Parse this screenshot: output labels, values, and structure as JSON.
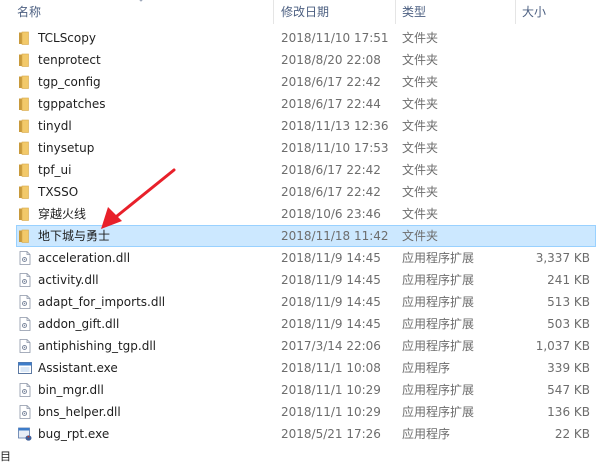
{
  "columns": {
    "name": "名称",
    "date": "修改日期",
    "type": "类型",
    "size": "大小"
  },
  "colors": {
    "selection_bg": "#cce8ff",
    "selection_border": "#99d1ff",
    "header_text": "#4d6082",
    "folder": "#dcb35c",
    "annotation_arrow": "#e8202a"
  },
  "files": [
    {
      "name": "TCLScopy",
      "date": "2018/11/10 17:51",
      "type": "文件夹",
      "size": "",
      "icon": "folder-icon"
    },
    {
      "name": "tenprotect",
      "date": "2018/8/20 22:08",
      "type": "文件夹",
      "size": "",
      "icon": "folder-icon"
    },
    {
      "name": "tgp_config",
      "date": "2018/6/17 22:42",
      "type": "文件夹",
      "size": "",
      "icon": "folder-icon"
    },
    {
      "name": "tgppatches",
      "date": "2018/6/17 22:44",
      "type": "文件夹",
      "size": "",
      "icon": "folder-icon"
    },
    {
      "name": "tinydl",
      "date": "2018/11/13 12:36",
      "type": "文件夹",
      "size": "",
      "icon": "folder-icon"
    },
    {
      "name": "tinysetup",
      "date": "2018/11/10 17:53",
      "type": "文件夹",
      "size": "",
      "icon": "folder-icon"
    },
    {
      "name": "tpf_ui",
      "date": "2018/6/17 22:42",
      "type": "文件夹",
      "size": "",
      "icon": "folder-icon"
    },
    {
      "name": "TXSSO",
      "date": "2018/6/17 22:42",
      "type": "文件夹",
      "size": "",
      "icon": "folder-icon"
    },
    {
      "name": "穿越火线",
      "date": "2018/10/6 23:46",
      "type": "文件夹",
      "size": "",
      "icon": "folder-icon"
    },
    {
      "name": "地下城与勇士",
      "date": "2018/11/18 11:42",
      "type": "文件夹",
      "size": "",
      "icon": "folder-icon",
      "selected": true
    },
    {
      "name": "acceleration.dll",
      "date": "2018/11/9 14:45",
      "type": "应用程序扩展",
      "size": "3,337 KB",
      "icon": "dll-icon"
    },
    {
      "name": "activity.dll",
      "date": "2018/11/9 14:45",
      "type": "应用程序扩展",
      "size": "241 KB",
      "icon": "dll-icon"
    },
    {
      "name": "adapt_for_imports.dll",
      "date": "2018/11/9 14:45",
      "type": "应用程序扩展",
      "size": "513 KB",
      "icon": "dll-icon"
    },
    {
      "name": "addon_gift.dll",
      "date": "2018/11/9 14:45",
      "type": "应用程序扩展",
      "size": "503 KB",
      "icon": "dll-icon"
    },
    {
      "name": "antiphishing_tgp.dll",
      "date": "2017/3/14 22:06",
      "type": "应用程序扩展",
      "size": "1,037 KB",
      "icon": "dll-icon"
    },
    {
      "name": "Assistant.exe",
      "date": "2018/11/1 10:08",
      "type": "应用程序",
      "size": "339 KB",
      "icon": "exe-window-icon"
    },
    {
      "name": "bin_mgr.dll",
      "date": "2018/11/1 10:29",
      "type": "应用程序扩展",
      "size": "547 KB",
      "icon": "dll-icon"
    },
    {
      "name": "bns_helper.dll",
      "date": "2018/11/1 10:29",
      "type": "应用程序扩展",
      "size": "136 KB",
      "icon": "dll-icon"
    },
    {
      "name": "bug_rpt.exe",
      "date": "2018/5/21 17:26",
      "type": "应用程序",
      "size": "22 KB",
      "icon": "exe-bug-icon"
    }
  ],
  "footer_glyph": "目"
}
